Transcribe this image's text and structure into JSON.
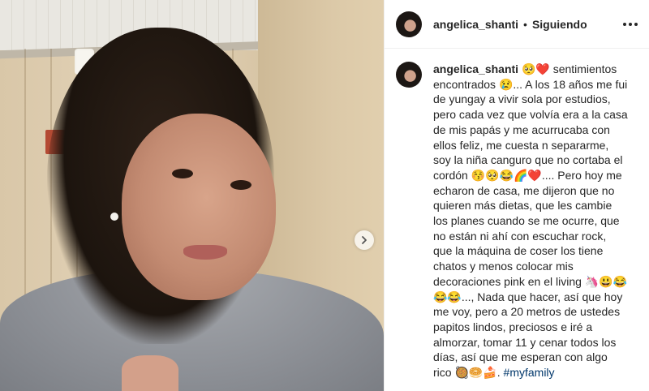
{
  "post": {
    "username": "angelica_shanti",
    "separator": "•",
    "follow_label": "Siguiendo",
    "more_icon": "more-horizontal-icon"
  },
  "caption": {
    "username": "angelica_shanti",
    "text": "🥺❤️ sentimientos encontrados 😢... A los 18 años me fui de yungay a vivir sola por estudios, pero cada vez que volvía era a la casa de mis papás y me acurrucaba con ellos feliz, me cuesta n separarme, soy la niña canguro que no cortaba el cordón 😚🥺😂🌈❤️.... Pero hoy me echaron de casa, me dijeron que no quieren más dietas, que les cambie los planes cuando se me ocurre, que no están ni ahí con escuchar rock, que la máquina de coser los tiene chatos y menos colocar mis decoraciones pink en el living 🦄😃😂😂😂..., Nada que hacer, así que hoy me voy, pero a 20 metros de ustedes papitos lindos, preciosos e iré a almorzar, tomar 11 y cenar todos los días, así que me esperan con algo rico 🥘🥯🍰. ",
    "hashtag": "#myfamily"
  },
  "carousel": {
    "next_icon": "chevron-right-icon"
  }
}
